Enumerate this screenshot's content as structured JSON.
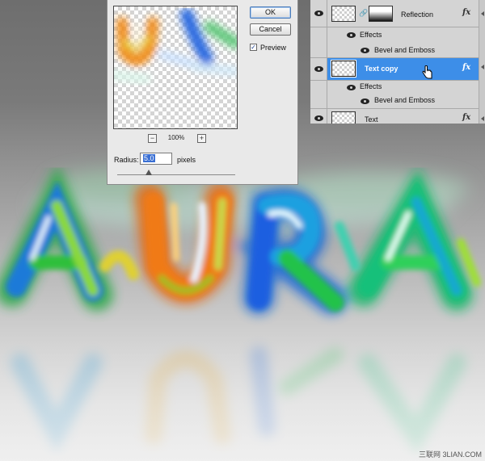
{
  "dialog": {
    "ok_label": "OK",
    "cancel_label": "Cancel",
    "preview_label": "Preview",
    "preview_checked": "✓",
    "zoom_level": "100%",
    "zoom_out": "−",
    "zoom_in": "+",
    "radius_label": "Radius:",
    "radius_value": "5.0",
    "radius_unit": "pixels"
  },
  "layers": {
    "rows": [
      {
        "name": "Reflection",
        "kind": "layer",
        "has_mask": true,
        "fx": "fx"
      },
      {
        "name": "Effects",
        "kind": "effects"
      },
      {
        "name": "Bevel and Emboss",
        "kind": "effect"
      },
      {
        "name": "Text copy",
        "kind": "layer",
        "selected": true,
        "fx": "fx"
      },
      {
        "name": "Effects",
        "kind": "effects"
      },
      {
        "name": "Bevel and Emboss",
        "kind": "effect"
      },
      {
        "name": "Text",
        "kind": "layer",
        "fx": "fx"
      }
    ],
    "selected_color": "#3d8ee8"
  },
  "artwork": {
    "text": "AURA"
  },
  "watermark": "三联网 3LIAN.COM"
}
